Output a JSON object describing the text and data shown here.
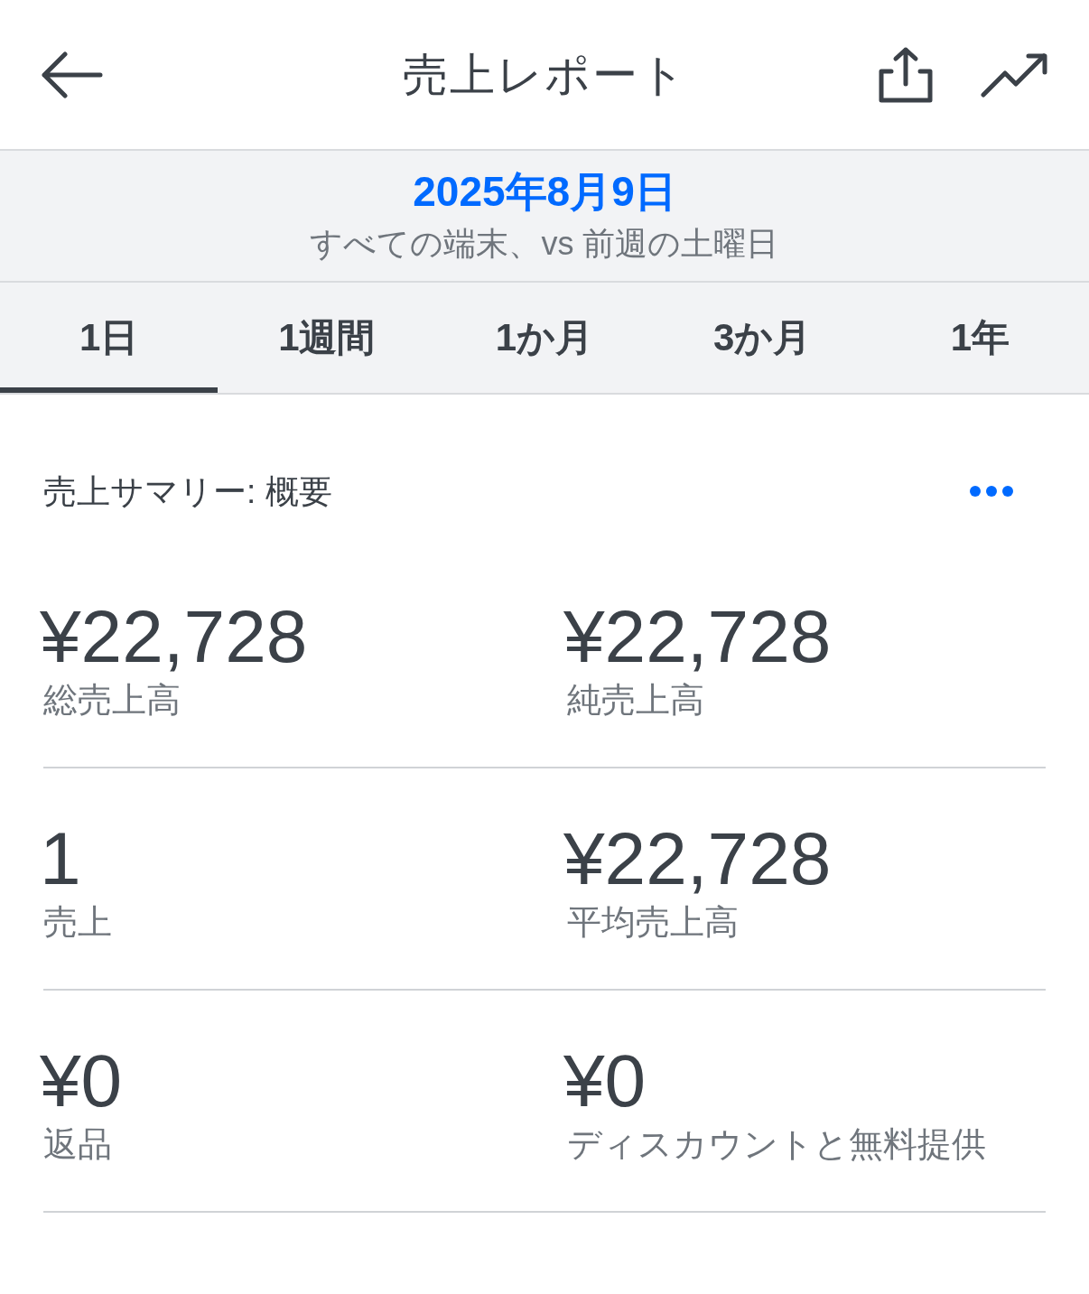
{
  "header": {
    "title": "売上レポート"
  },
  "date_range": {
    "date": "2025年8月9日",
    "comparison": "すべての端末、vs 前週の土曜日"
  },
  "tabs": [
    {
      "label": "1日",
      "selected": true
    },
    {
      "label": "1週間",
      "selected": false
    },
    {
      "label": "1か月",
      "selected": false
    },
    {
      "label": "3か月",
      "selected": false
    },
    {
      "label": "1年",
      "selected": false
    }
  ],
  "summary": {
    "title": "売上サマリー: 概要",
    "rows": [
      {
        "cells": [
          {
            "value": "¥22,728",
            "label": "総売上高"
          },
          {
            "value": "¥22,728",
            "label": "純売上高"
          }
        ]
      },
      {
        "cells": [
          {
            "value": "1",
            "label": "売上"
          },
          {
            "value": "¥22,728",
            "label": "平均売上高"
          }
        ]
      },
      {
        "cells": [
          {
            "value": "¥0",
            "label": "返品"
          },
          {
            "value": "¥0",
            "label": "ディスカウントと無料提供"
          }
        ]
      }
    ]
  }
}
